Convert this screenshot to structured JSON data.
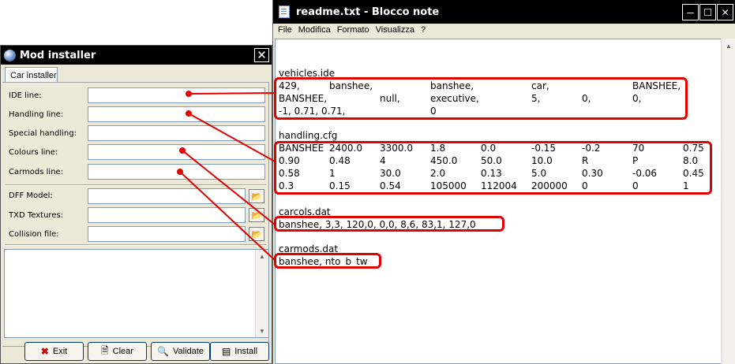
{
  "mod_installer": {
    "title": "Mod installer",
    "close_glyph": "✕",
    "tab_label": "Car installer",
    "fields": [
      {
        "label": "IDE line:",
        "value": ""
      },
      {
        "label": "Handling line:",
        "value": ""
      },
      {
        "label": "Special handling:",
        "value": ""
      },
      {
        "label": "Colours line:",
        "value": ""
      },
      {
        "label": "Carmods line:",
        "value": ""
      }
    ],
    "file_fields": [
      {
        "label": "DFF Model:",
        "value": ""
      },
      {
        "label": "TXD Textures:",
        "value": ""
      },
      {
        "label": "Collision file:",
        "value": ""
      }
    ],
    "buttons": {
      "exit": "Exit",
      "clear": "Clear",
      "validate": "Validate",
      "install": "Install"
    },
    "icons": {
      "app": "globe-icon",
      "browse": "folder-open-icon",
      "exit": "red-x-icon",
      "clear": "document-icon",
      "validate": "magnifier-icon",
      "install": "list-icon"
    }
  },
  "notepad": {
    "title": "readme.txt - Blocco note",
    "menu": [
      "File",
      "Modifica",
      "Formato",
      "Visualizza",
      "?"
    ],
    "sections": {
      "vehicles": {
        "header": "vehicles.ide",
        "rows": [
          [
            "429,",
            "banshee,",
            "banshee,",
            "car,",
            "BANSHEE,"
          ],
          [
            "BANSHEE,",
            "null,",
            "executive,",
            "5,",
            "0,",
            "0,"
          ],
          [
            "-1, 0.71, 0.71,",
            "0"
          ]
        ]
      },
      "handling": {
        "header": "handling.cfg",
        "rows": [
          [
            "BANSHEE",
            "2400.0",
            "3300.0",
            "1.8",
            "0.0",
            "-0.15",
            "-0.2",
            "70",
            "0.75"
          ],
          [
            "0.90",
            "0.48",
            "4",
            "450.0",
            "50.0",
            "10.0",
            "R",
            "P",
            "8.0"
          ],
          [
            "0.58",
            "1",
            "30.0",
            "2.0",
            "0.13",
            "5.0",
            "0.30",
            "-0.06",
            "0.45"
          ],
          [
            "0.3",
            "0.15",
            "0.54",
            "105000",
            "112004",
            "200000",
            "0",
            "0",
            "1"
          ]
        ]
      },
      "carcols": {
        "header": "carcols.dat",
        "line": "banshee, 3,3, 120,0, 0,0, 8,6, 83,1, 127,0"
      },
      "carmods": {
        "header": "carmods.dat",
        "line": "banshee, nto_b_tw"
      }
    }
  },
  "colors": {
    "annotation": "#e00000",
    "titlebar": "#000000",
    "window": "#ece9d8"
  }
}
